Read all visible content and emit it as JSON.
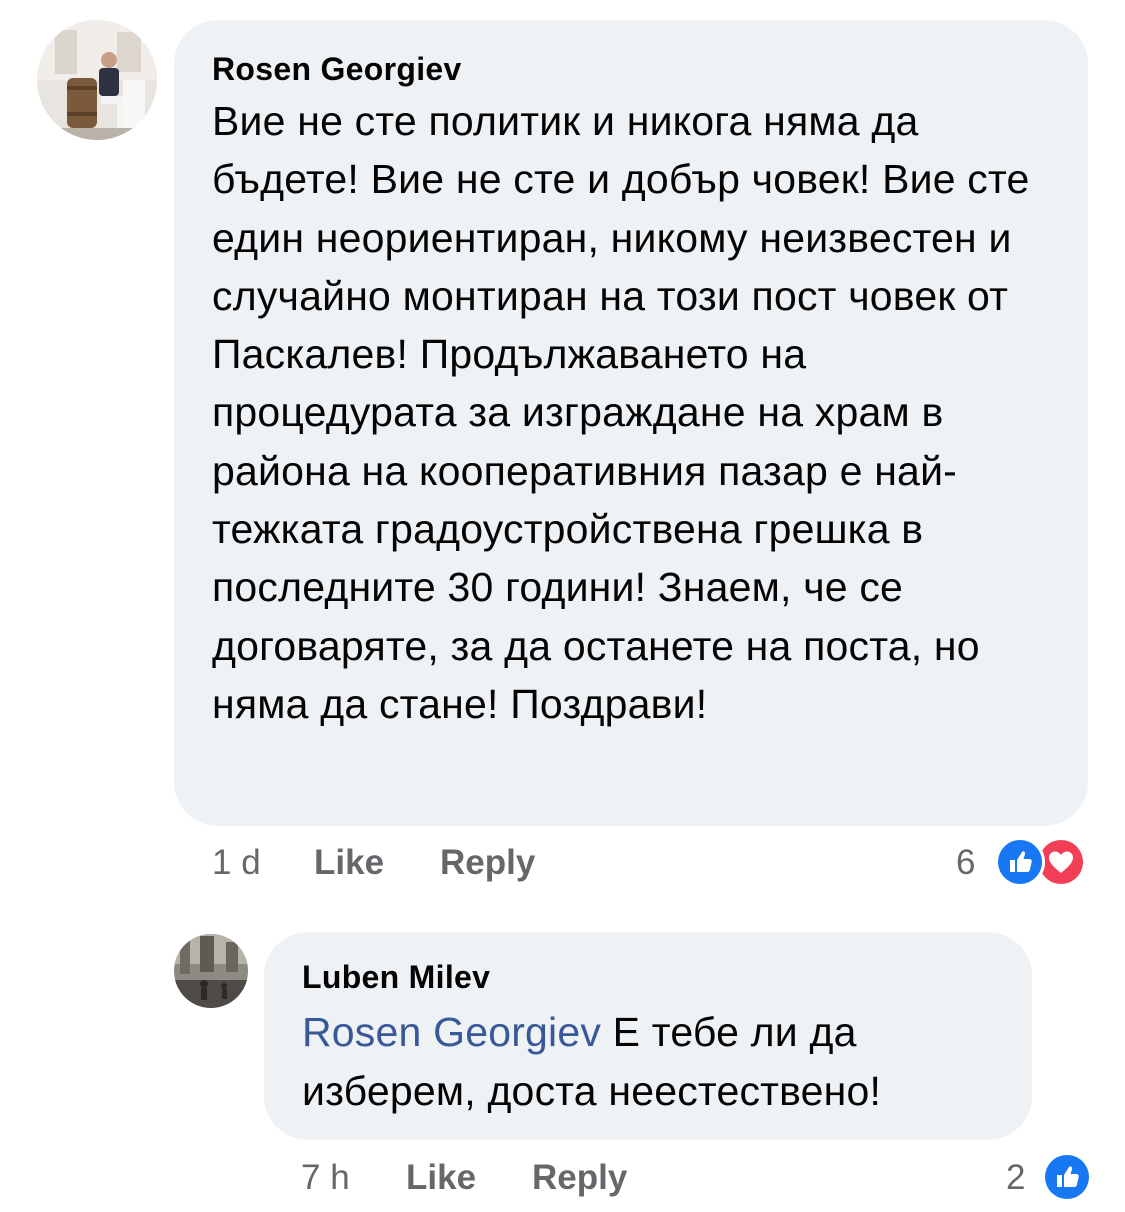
{
  "comments": [
    {
      "author": "Rosen Georgiev",
      "body": "Вие не сте политик и никога няма да бъдете! Вие не сте и добър човек! Вие сте един неориентиран, никому неизвестен и случайно монтиран на този пост човек от Паскалев! Продължаването на процедурата за изграждане на храм в района на кооперативния пазар е най-тежката градоустройствена грешка в последните 30 години! Знаем, че се договаряте, за да останете на поста, но няма да стане! Поздрави!",
      "time": "1 d",
      "like_label": "Like",
      "reply_label": "Reply",
      "reaction_count": "6",
      "reactions": [
        "like-icon",
        "love-icon"
      ]
    },
    {
      "author": "Luben Milev",
      "mention": "Rosen Georgiev",
      "body": " Е тебе ли да изберем, доста неестествено!",
      "time": "7 h",
      "like_label": "Like",
      "reply_label": "Reply",
      "reaction_count": "2",
      "reactions": [
        "like-icon"
      ]
    }
  ],
  "colors": {
    "bubble": "#eff2f5",
    "mention": "#385898",
    "secondary_text": "#65676b",
    "like_blue": "#1877f2",
    "love_red": "#f33e58"
  }
}
